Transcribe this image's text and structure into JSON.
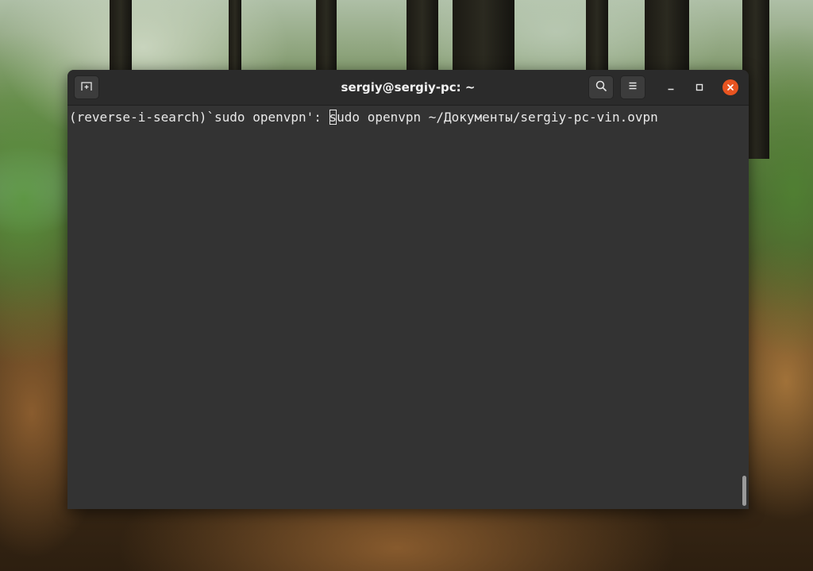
{
  "window": {
    "title": "sergiy@sergiy-pc: ~"
  },
  "header_buttons": {
    "new_tab_icon": "new-tab-icon",
    "search_icon": "search-icon",
    "menu_icon": "hamburger-menu-icon"
  },
  "window_controls": {
    "minimize_icon": "minimize-icon",
    "maximize_icon": "maximize-icon",
    "close_icon": "close-icon",
    "close_color": "#e95420"
  },
  "terminal": {
    "prompt_prefix": "(reverse-i-search)`sudo openvpn': ",
    "cursor_char": "s",
    "command_rest": "udo openvpn ~/Документы/sergiy-pc-vin.ovpn",
    "background_color": "#333333",
    "text_color": "#e9e9e9"
  }
}
